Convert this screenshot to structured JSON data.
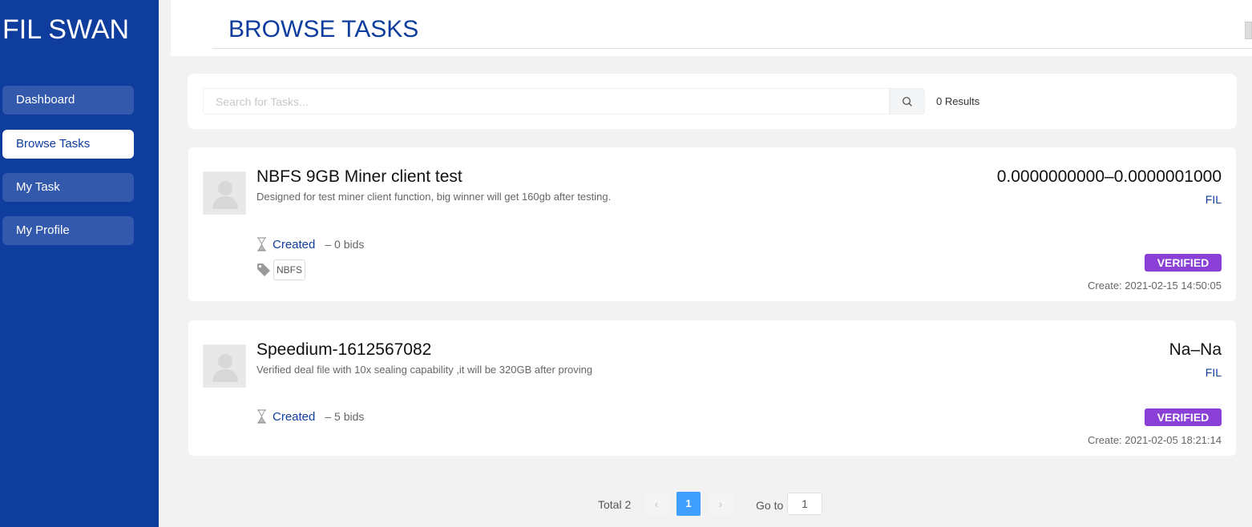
{
  "app": {
    "brand": "FIL SWAN"
  },
  "sidebar": {
    "items": [
      {
        "label": "Dashboard"
      },
      {
        "label": "Browse Tasks",
        "active": true
      },
      {
        "label": "My Task"
      },
      {
        "label": "My Profile"
      }
    ]
  },
  "header": {
    "title": "BROWSE TASKS"
  },
  "search": {
    "placeholder": "Search for Tasks...",
    "value": "",
    "results": "0 Results",
    "icon": "search-icon"
  },
  "tasks": [
    {
      "title": "NBFS 9GB Miner client test",
      "description": "Designed for test miner client function, big winner will get 160gb after testing.",
      "status": "Created",
      "bids": "– 0 bids",
      "tag": "NBFS",
      "price": "0.0000000000–0.0000001000",
      "currency": "FIL",
      "badge": "VERIFIED",
      "created": "Create: 2021-02-15 14:50:05"
    },
    {
      "title": "Speedium-1612567082",
      "description": "Verified deal file with 10x sealing capability ,it will be 320GB after proving",
      "status": "Created",
      "bids": "– 5 bids",
      "price": "Na–Na",
      "currency": "FIL",
      "badge": "VERIFIED",
      "created": "Create: 2021-02-05 18:21:14"
    }
  ],
  "pagination": {
    "total": "Total 2",
    "prev": "‹",
    "current": "1",
    "next": "›",
    "goto_label": "Go to",
    "goto_value": "1"
  },
  "colors": {
    "sidebar": "#0f3d9e",
    "nav_item": "#3359ad",
    "verified": "#8a3fd6",
    "page_active": "#409eff"
  }
}
